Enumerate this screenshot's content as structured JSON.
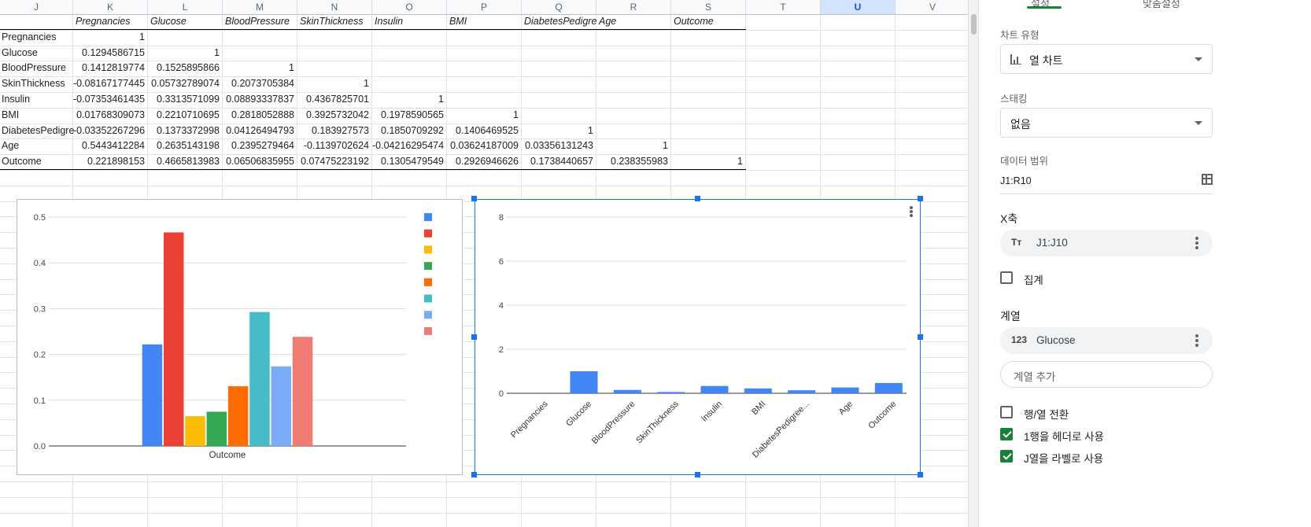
{
  "sheet": {
    "columns": [
      "J",
      "K",
      "L",
      "M",
      "N",
      "O",
      "P",
      "Q",
      "R",
      "S",
      "T",
      "U",
      "V"
    ],
    "selected_column": "U",
    "header_row": [
      "Pregnancies",
      "Glucose",
      "BloodPressure",
      "SkinThickness",
      "Insulin",
      "BMI",
      "DiabetesPedigre",
      "Age",
      "Outcome"
    ],
    "rows": [
      {
        "label": "Pregnancies",
        "values": [
          "1",
          "",
          "",
          "",
          "",
          "",
          "",
          "",
          ""
        ]
      },
      {
        "label": "Glucose",
        "values": [
          "0.1294586715",
          "1",
          "",
          "",
          "",
          "",
          "",
          "",
          ""
        ]
      },
      {
        "label": "BloodPressure",
        "values": [
          "0.1412819774",
          "0.1525895866",
          "1",
          "",
          "",
          "",
          "",
          "",
          ""
        ]
      },
      {
        "label": "SkinThickness",
        "values": [
          "-0.08167177445",
          "0.05732789074",
          "0.2073705384",
          "1",
          "",
          "",
          "",
          "",
          ""
        ]
      },
      {
        "label": "Insulin",
        "values": [
          "-0.07353461435",
          "0.3313571099",
          "0.08893337837",
          "0.4367825701",
          "1",
          "",
          "",
          "",
          ""
        ]
      },
      {
        "label": "BMI",
        "values": [
          "0.01768309073",
          "0.2210710695",
          "0.2818052888",
          "0.3925732042",
          "0.1978590565",
          "1",
          "",
          "",
          ""
        ]
      },
      {
        "label": "DiabetesPedigre",
        "values": [
          "-0.03352267296",
          "0.1373372998",
          "0.04126494793",
          "0.183927573",
          "0.1850709292",
          "0.1406469525",
          "1",
          "",
          ""
        ]
      },
      {
        "label": "Age",
        "values": [
          "0.5443412284",
          "0.2635143198",
          "0.2395279464",
          "-0.1139702624",
          "-0.04216295474",
          "0.03624187009",
          "0.03356131243",
          "1",
          ""
        ]
      },
      {
        "label": "Outcome",
        "values": [
          "0.221898153",
          "0.4665813983",
          "0.06506835955",
          "0.07475223192",
          "0.1305479549",
          "0.2926946626",
          "0.1738440657",
          "0.238355983",
          "1"
        ]
      }
    ]
  },
  "chart_data": [
    {
      "type": "bar",
      "categories": [
        "Outcome"
      ],
      "series": [
        {
          "values": [
            0.2219
          ],
          "color": "#4285f4"
        },
        {
          "values": [
            0.4666
          ],
          "color": "#ea4335"
        },
        {
          "values": [
            0.0651
          ],
          "color": "#fbbc04"
        },
        {
          "values": [
            0.0748
          ],
          "color": "#34a853"
        },
        {
          "values": [
            0.1305
          ],
          "color": "#ff6d01"
        },
        {
          "values": [
            0.2927
          ],
          "color": "#46bdc6"
        },
        {
          "values": [
            0.1738
          ],
          "color": "#7baaf7"
        },
        {
          "values": [
            0.2384
          ],
          "color": "#f07b72"
        }
      ],
      "y_ticks": [
        "0.0",
        "0.1",
        "0.2",
        "0.3",
        "0.4",
        "0.5"
      ],
      "ylim": [
        0,
        0.5
      ],
      "grid": true,
      "legend": "right"
    },
    {
      "type": "bar",
      "categories": [
        "Pregnancies",
        "Glucose",
        "BloodPressure",
        "SkinThickness",
        "Insulin",
        "BMI",
        "DiabetesPedigree...",
        "Age",
        "Outcome"
      ],
      "series": [
        {
          "values": [
            0,
            1,
            0.1526,
            0.0573,
            0.3314,
            0.2211,
            0.1373,
            0.2635,
            0.4666
          ],
          "color": "#4285f4"
        }
      ],
      "y_ticks": [
        "0",
        "2",
        "4",
        "6",
        "8"
      ],
      "ylim": [
        0,
        8
      ],
      "grid": true,
      "selected": true
    }
  ],
  "panel": {
    "tabs": [
      "설정",
      "맞춤설정"
    ],
    "chart_type_label": "차트 유형",
    "chart_type_value": "열 차트",
    "stacking_label": "스태킹",
    "stacking_value": "없음",
    "data_range_label": "데이터 범위",
    "data_range_value": "J1:R10",
    "x_axis_title": "X축",
    "x_axis_icon": "Tт",
    "x_axis_value": "J1:J10",
    "aggregate_label": "집계",
    "series_title": "계열",
    "series_icon": "123",
    "series_value": "Glucose",
    "add_series_label": "계열 추가",
    "switch_rows_cols_label": "행/열 전환",
    "row1_header_label": "1행을 헤더로 사용",
    "colJ_label_label": "J열을 라벨로 사용",
    "checkbox_states": {
      "aggregate": false,
      "switch": false,
      "row1_header": true,
      "colJ_labels": true
    },
    "accent_color": "#188038"
  }
}
